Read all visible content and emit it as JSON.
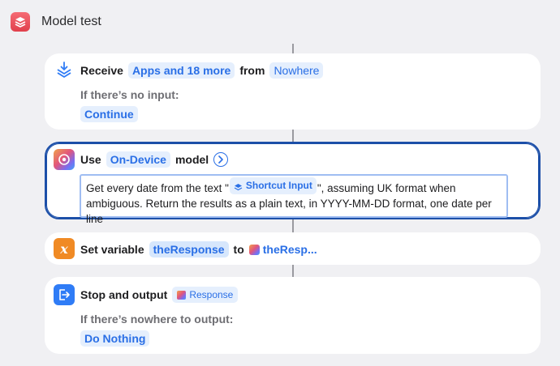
{
  "window": {
    "title": "Model test",
    "icon": "shortcuts-stack-icon"
  },
  "actions": {
    "receive": {
      "verb": "Receive",
      "types_token": "Apps and 18 more",
      "from_label": "from",
      "source_token": "Nowhere",
      "no_input_label": "If there’s no input:",
      "no_input_token": "Continue"
    },
    "use_model": {
      "verb": "Use",
      "model_token": "On-Device",
      "model_label": "model",
      "prompt_prefix": "Get every date from the text \"",
      "prompt_variable": "Shortcut Input",
      "prompt_suffix": "\", assuming UK format when ambiguous. Return the results as a plain text, in YYYY-MM-DD format, one date per line"
    },
    "set_variable": {
      "verb": "Set variable",
      "variable_token": "theResponse",
      "to_label": "to",
      "value_token": "theResp..."
    },
    "stop_output": {
      "verb": "Stop and output",
      "output_token": "Response",
      "nowhere_label": "If there’s nowhere to output:",
      "nowhere_token": "Do Nothing"
    }
  },
  "colors": {
    "accent": "#2a6fe6",
    "token_bg": "#e5effd",
    "selection": "#1c4fa8",
    "app_icon": "#e1404c",
    "variable_icon": "#f08a24",
    "stop_icon": "#2f7cf6"
  }
}
